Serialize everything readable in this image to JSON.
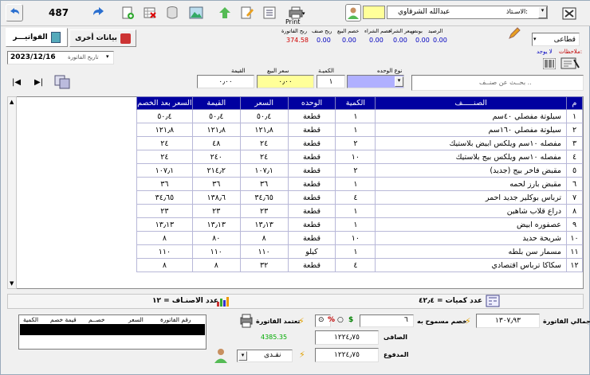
{
  "toolbar": {
    "counter": "487",
    "print_label": "Print",
    "customer_label": "الاسـتاذ:",
    "customer_value": "عبدالله الشرقاوي"
  },
  "tabs": [
    {
      "label": "الفواتيـــر"
    },
    {
      "label": "بيانات أخرى"
    }
  ],
  "sale_type": "قطاعى",
  "notes_label": "ملاحظات:",
  "notes_value": "لا يوجد",
  "invoice_date_label": "تاريخ الفاتورة",
  "invoice_date": "2023/12/16",
  "summary_top": {
    "labels": [
      "ربح الفاتورة",
      "ربح صنف",
      "خصم البيع",
      "خصم الشراء",
      "سعر الشراء",
      "بونص",
      "الرصيد"
    ],
    "values": [
      "374.58",
      "0.00",
      "0.00",
      "0.00",
      "0.00",
      "0.00",
      "0.00"
    ]
  },
  "entry": {
    "unit_type_label": "نوع الوحده",
    "qty_label": "الكميـة",
    "price_label": "سعر البيع",
    "value_label": "القيمة",
    "qty_value": "١",
    "price_value": "٠٫٠٠",
    "value_value": "٠٫٠٠",
    "search_placeholder": "بحــث عن صنــف .."
  },
  "table": {
    "headers": [
      "م",
      "الصنـــــف",
      "الكمية",
      "الوحده",
      "السعر",
      "القيمة",
      "السعر بعد الخصم"
    ],
    "rows": [
      [
        "١",
        "سيلوتة مفصلي ٤٠سم",
        "١",
        "قطعة",
        "٥٠٫٤",
        "٥٠٫٤",
        "٥٠٫٤"
      ],
      [
        "٢",
        "سيلوتة مفصلي ١٦٠سم",
        "١",
        "قطعة",
        "١٢١٫٨",
        "١٢١٫٨",
        "١٢١٫٨"
      ],
      [
        "٣",
        "مفصله ١٠سم ويلكس ابيض بلاستيك",
        "٢",
        "قطعة",
        "٢٤",
        "٤٨",
        "٢٤"
      ],
      [
        "٤",
        "مفصله ١٠سم ويلكس بيج بلاستيك",
        "١٠",
        "قطعة",
        "٢٤",
        "٢٤٠",
        "٢٤"
      ],
      [
        "٥",
        "مقبض فاخر بيج (جديد)",
        "٢",
        "قطعة",
        "١٠٧٫١",
        "٢١٤٫٢",
        "١٠٧٫١"
      ],
      [
        "٦",
        "مقبض بارز لحمه",
        "١",
        "قطعة",
        "٣٦",
        "٣٦",
        "٣٦"
      ],
      [
        "٧",
        "ترباس بوكلير جديد احمر",
        "٤",
        "قطعة",
        "٣٤٫٦٥",
        "١٣٨٫٦",
        "٣٤٫٦٥"
      ],
      [
        "٨",
        "دراع قلاب شاهين",
        "١",
        "قطعة",
        "٢٣",
        "٢٣",
        "٢٣"
      ],
      [
        "٩",
        "عصفوره ابيض",
        "١",
        "قطعة",
        "١٣٫١٣",
        "١٣٫١٣",
        "١٣٫١٣"
      ],
      [
        "١٠",
        "شريحة حديد",
        "١٠",
        "قطعة",
        "٨",
        "٨٠",
        "٨"
      ],
      [
        "١١",
        "مسمار سن بلطه",
        "١",
        "كيلو",
        "١١٠",
        "١١٠",
        "١١٠"
      ],
      [
        "١٢",
        "سكاكا ترباس اقتصادي",
        "٤",
        "قطعة",
        "٣٢",
        "٨",
        "٨"
      ]
    ]
  },
  "status": {
    "items_count_label": "عدد الاصنـاف = ١٢",
    "qty_count_label": "عدد كميات = ٤٢٫٤"
  },
  "bottom_grid": {
    "headers": [
      "رقم الفاتورة",
      "السعر",
      "خصــم",
      "قيمة خصم",
      "الكمية"
    ]
  },
  "totals": {
    "invoice_total_label": "إجمالي الفاتورة",
    "invoice_total": "١٣٠٧٫٩٣",
    "allowed_discount_label": "خصم مسموح به",
    "allowed_discount": "٦",
    "percent_label": "%",
    "dollar_label": "$",
    "net_label": "الصافى",
    "net_value": "١٢٢٤٫٧٥",
    "paid_label": "المدفوع",
    "paid_value": "١٢٢٤٫٧٥",
    "approve_label": "تعتمد الفاتورة",
    "green_value": "4385.35",
    "payment_type": "نقـدى"
  },
  "colors": {
    "header_blue": "#0000a0",
    "yellow": "#ffff99",
    "lavender": "#b0b0ff"
  }
}
